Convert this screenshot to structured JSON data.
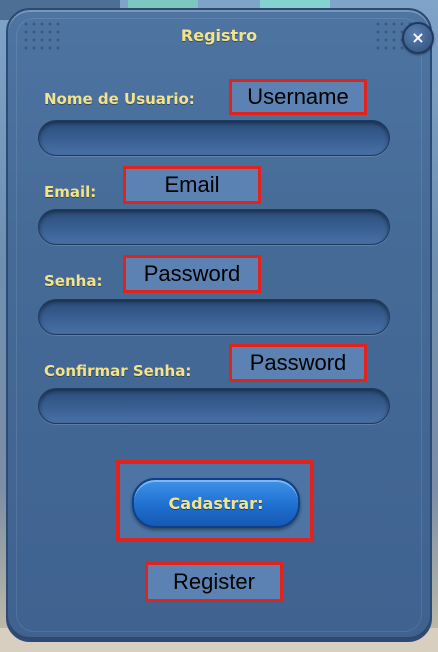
{
  "dialog": {
    "title": "Registro",
    "close_icon": "×"
  },
  "fields": [
    {
      "label": "Nome de Usuario:",
      "annotation": "Username",
      "value": ""
    },
    {
      "label": "Email:",
      "annotation": "Email",
      "value": ""
    },
    {
      "label": "Senha:",
      "annotation": "Password",
      "value": ""
    },
    {
      "label": "Confirmar Senha:",
      "annotation": "Password",
      "value": ""
    }
  ],
  "submit": {
    "label": "Cadastrar:",
    "annotation": "Register"
  },
  "colors": {
    "panel": "#466b97",
    "label_text": "#f3e38a",
    "highlight_border": "#e0231d",
    "button": "#1f6fd1"
  }
}
